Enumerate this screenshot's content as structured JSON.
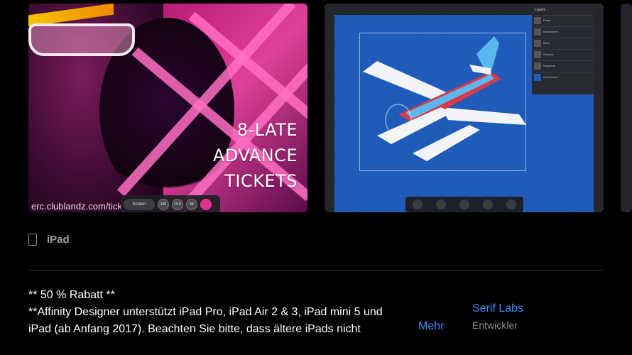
{
  "screenshots": {
    "poster": {
      "lines": [
        "8-LATE",
        "ADVANCE",
        "TICKETS"
      ],
      "url": "erc.clublandz.com/tick",
      "panel": {
        "mode": "Screen",
        "values": [
          "100",
          "19.0",
          "56"
        ]
      }
    },
    "app": {
      "layers_title": "Layers",
      "layer_names": [
        "Plane",
        "Moustaches",
        "Birds",
        "Shadow",
        "Seaplane",
        "Sea/Colour"
      ]
    }
  },
  "device": {
    "label": "iPad",
    "icon": "tablet-icon"
  },
  "description": {
    "lines": [
      "** 50 % Rabatt **",
      "**Affinity Designer unterstützt iPad Pro, iPad Air 2 & 3, iPad mini 5 und",
      "iPad (ab Anfang 2017). Beachten Sie bitte, dass ältere iPads nicht"
    ],
    "more": "Mehr"
  },
  "developer": {
    "name": "Serif Labs",
    "role": "Entwickler"
  },
  "colors": {
    "link": "#3e8ef7",
    "secondary": "#8e8e93",
    "accent_pink": "#e0338f"
  }
}
